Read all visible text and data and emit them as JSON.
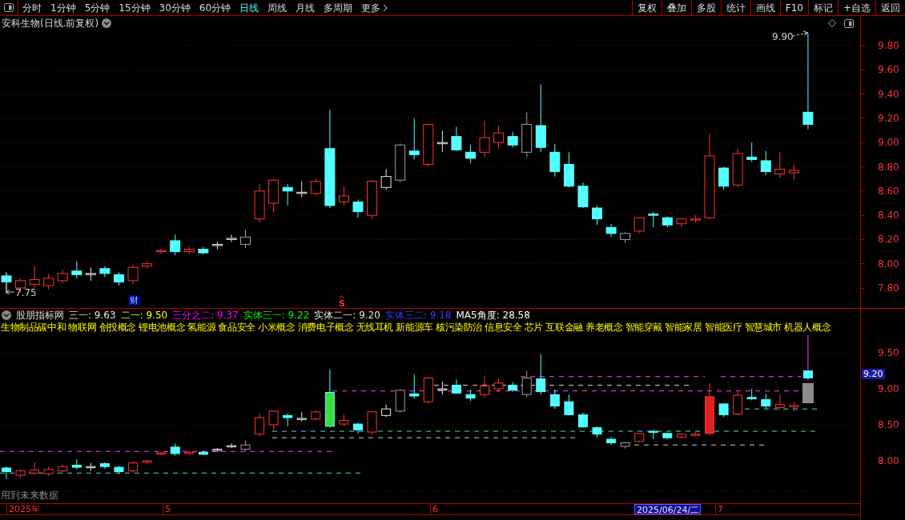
{
  "toolbar": {
    "tabs": [
      {
        "label": "分时",
        "selected": false
      },
      {
        "label": "1分钟",
        "selected": false
      },
      {
        "label": "5分钟",
        "selected": false
      },
      {
        "label": "15分钟",
        "selected": false
      },
      {
        "label": "30分钟",
        "selected": false
      },
      {
        "label": "60分钟",
        "selected": false
      },
      {
        "label": "日线",
        "selected": true
      },
      {
        "label": "周线",
        "selected": false
      },
      {
        "label": "月线",
        "selected": false
      },
      {
        "label": "多周期",
        "selected": false
      },
      {
        "label": "更多",
        "selected": false
      }
    ],
    "buttons": [
      "复权",
      "叠加",
      "多股",
      "统计",
      "画线",
      "F10",
      "标记",
      "+自选",
      "返回"
    ]
  },
  "chart_title": "安科生物(日线.前复权)",
  "price_axis": [
    "9.80",
    "9.60",
    "9.40",
    "9.20",
    "9.00",
    "8.80",
    "8.60",
    "8.40",
    "8.20",
    "8.00",
    "7.80"
  ],
  "high_label": "9.90",
  "low_label": "7.75",
  "markers": [
    {
      "kind": "finance",
      "text": "财"
    },
    {
      "kind": "signal",
      "text": "S"
    }
  ],
  "indicator": {
    "name": "股朋指标网",
    "legend": [
      {
        "text": "三一: 9.63",
        "color": "#e6e6e6"
      },
      {
        "text": "二一: 9.50",
        "color": "#ffff00"
      },
      {
        "text": "三分之二: 9.37",
        "color": "#ff00ff"
      },
      {
        "text": "实体三一: 9.22",
        "color": "#00ff00"
      },
      {
        "text": "实体二一: 9.20",
        "color": "#e6e6e6"
      },
      {
        "text": "实体三二: 9.18",
        "color": "#3c3cff"
      },
      {
        "text": "MA5角度: 28.58",
        "color": "#ffffff"
      }
    ],
    "concepts": "生物制品碳中和 物联网 创投概念 锂电池概念 氢能源 食品安全 小米概念 消费电子概念 无线耳机 新能源车 核污染防治 信息安全 芯片 互联金融 养老概念 智能穿戴 智能家居 智能医疗 智慧城市 机器人概念",
    "axis": [
      "9.50",
      "9.00",
      "8.50",
      "8.00"
    ],
    "current_value": "9.20",
    "note": "用到未来数据"
  },
  "time_axis": [
    {
      "label": "2025年",
      "selected": false
    },
    {
      "label": "5",
      "selected": false
    },
    {
      "label": "6",
      "selected": false
    },
    {
      "label": "2025/06/24/二",
      "selected": true
    },
    {
      "label": "7",
      "selected": false
    }
  ]
}
